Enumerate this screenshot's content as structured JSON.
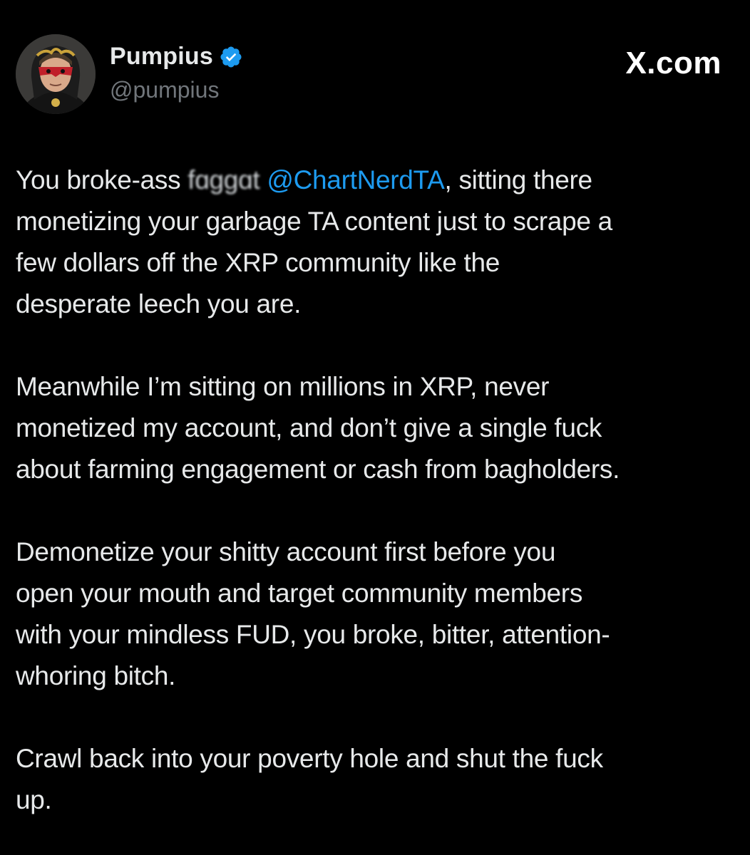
{
  "tweet": {
    "author": {
      "display_name": "Pumpius",
      "handle": "@pumpius",
      "verified": true,
      "verified_icon": "verified-badge-icon",
      "avatar": "avatar-image"
    },
    "brand": "X.com",
    "colors": {
      "background": "#000000",
      "text": "#e7e9ea",
      "secondary_text": "#71767b",
      "mention": "#1d9bf0",
      "verified": "#1d9bf0"
    },
    "paragraphs": [
      {
        "lines": [
          {
            "before": "You broke-ass ",
            "blurred": "fɑggɑt",
            "mention": "@ChartNerdTA",
            "after": ", sitting there"
          },
          {
            "text": "monetizing your garbage TA content just to scrape a"
          },
          {
            "text": "few dollars off the XRP community like the"
          },
          {
            "text": "desperate leech you are."
          }
        ]
      },
      {
        "lines": [
          {
            "text": "Meanwhile I’m sitting on millions in XRP, never"
          },
          {
            "text": "monetized my account, and don’t give a single fuck"
          },
          {
            "text": "about farming engagement or cash from bagholders."
          }
        ]
      },
      {
        "lines": [
          {
            "text": "Demonetize your shitty account first before you"
          },
          {
            "text": "open your mouth and target community members"
          },
          {
            "text": "with your mindless FUD, you broke, bitter, attention-"
          },
          {
            "text": "whoring bitch."
          }
        ]
      },
      {
        "lines": [
          {
            "text": "Crawl back into your poverty hole and shut the fuck"
          },
          {
            "text": "up."
          }
        ]
      }
    ]
  }
}
